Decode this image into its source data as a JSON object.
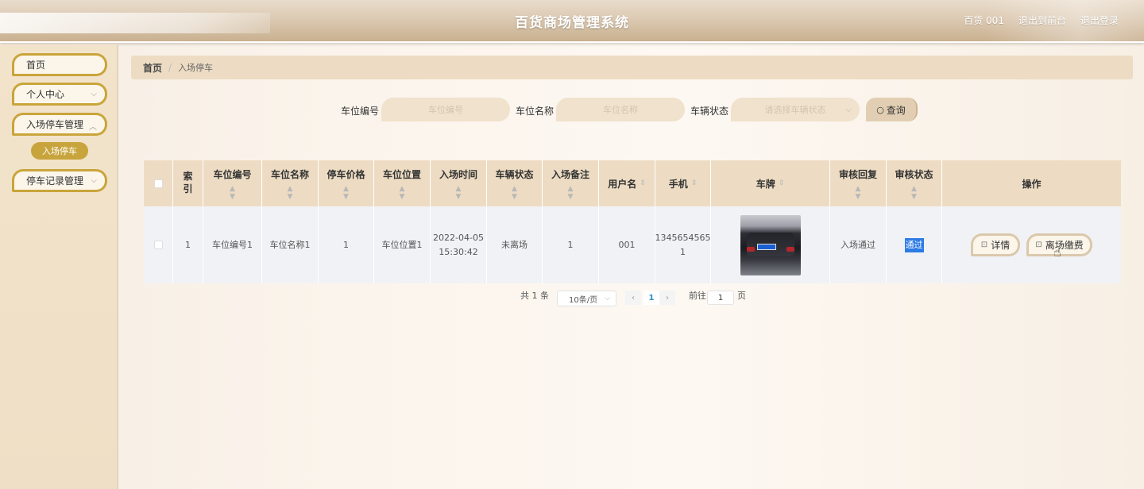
{
  "header": {
    "title": "百货商场管理系统",
    "user_label": "百货 001",
    "front_link": "退出到前台",
    "logout_link": "退出登录"
  },
  "sidebar": {
    "items": [
      {
        "label": "首页"
      },
      {
        "label": "个人中心"
      },
      {
        "label": "入场停车管理",
        "children": [
          {
            "label": "入场停车"
          }
        ]
      },
      {
        "label": "停车记录管理"
      }
    ]
  },
  "breadcrumb": {
    "home": "首页",
    "current": "入场停车"
  },
  "filters": {
    "space_no_label": "车位编号",
    "space_no_placeholder": "车位编号",
    "space_name_label": "车位名称",
    "space_name_placeholder": "车位名称",
    "status_label": "车辆状态",
    "status_placeholder": "请选择车辆状态",
    "query_label": "查询"
  },
  "table": {
    "columns": [
      "索引",
      "车位编号",
      "车位名称",
      "停车价格",
      "车位位置",
      "入场时间",
      "车辆状态",
      "入场备注",
      "用户名",
      "手机",
      "车牌",
      "审核回复",
      "审核状态",
      "操作"
    ],
    "rows": [
      {
        "index": "1",
        "space_no": "车位编号1",
        "space_name": "车位名称1",
        "price": "1",
        "location": "车位位置1",
        "entry_date": "2022-04-05",
        "entry_time": "15:30:42",
        "vehicle_status": "未离场",
        "remark": "1",
        "username": "001",
        "phone_line1": "1345654565",
        "phone_line2": "1",
        "review_reply": "入场通过",
        "review_status": "通过",
        "actions": {
          "detail": "详情",
          "leave_pay": "离场缴费"
        }
      }
    ]
  },
  "pagination": {
    "total_prefix": "共",
    "total": "1",
    "total_suffix": "条",
    "page_size": "10条/页",
    "current_page": "1",
    "goto_prefix": "前往",
    "goto_value": "1",
    "goto_suffix": "页"
  }
}
